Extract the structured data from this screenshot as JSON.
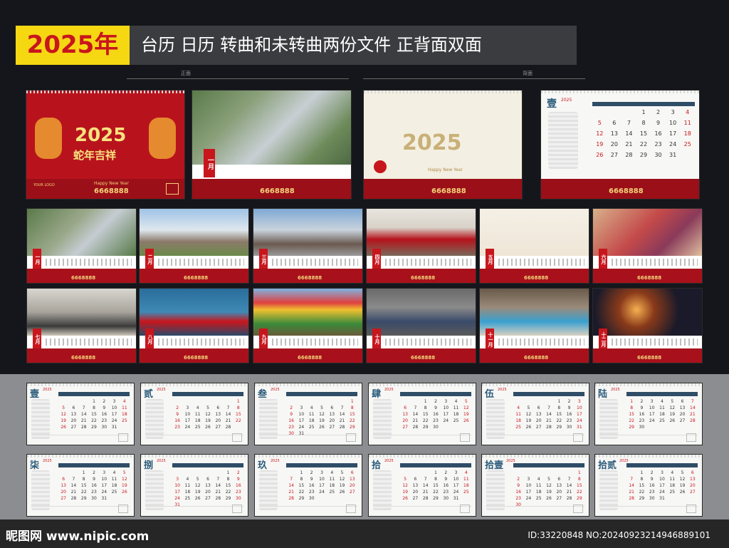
{
  "header": {
    "year": "2025年",
    "title": "台历 日历 转曲和未转曲两份文件 正背面双面",
    "label_front": "正面",
    "label_back": "背面"
  },
  "cover": {
    "year": "2025",
    "blessing": "蛇年吉祥",
    "greeting": "Happy New Year",
    "phone": "6668888",
    "logo": "YOUR LOGO"
  },
  "back_cover": {
    "year": "2025",
    "greeting": "Happy New Year"
  },
  "front_months": [
    {
      "tag": "一月",
      "theme": "aerial"
    },
    {
      "tag": "二月",
      "theme": "building"
    },
    {
      "tag": "三月",
      "theme": "mall"
    },
    {
      "tag": "四月",
      "theme": "sofa"
    },
    {
      "tag": "五月",
      "theme": "floorplan"
    },
    {
      "tag": "六月",
      "theme": "shopping"
    },
    {
      "tag": "七月",
      "theme": "interior"
    },
    {
      "tag": "八月",
      "theme": "ferris"
    },
    {
      "tag": "九月",
      "theme": "kite"
    },
    {
      "tag": "十月",
      "theme": "art"
    },
    {
      "tag": "十一月",
      "theme": "pool"
    },
    {
      "tag": "十二月",
      "theme": "sparkler"
    }
  ],
  "back_months": [
    {
      "num": "壹",
      "start": 3,
      "days": 31
    },
    {
      "num": "贰",
      "start": 6,
      "days": 28
    },
    {
      "num": "叁",
      "start": 6,
      "days": 31
    },
    {
      "num": "肆",
      "start": 2,
      "days": 30
    },
    {
      "num": "伍",
      "start": 4,
      "days": 31
    },
    {
      "num": "陆",
      "start": 0,
      "days": 30
    },
    {
      "num": "柒",
      "start": 2,
      "days": 31
    },
    {
      "num": "捌",
      "start": 5,
      "days": 31
    },
    {
      "num": "玖",
      "start": 1,
      "days": 30
    },
    {
      "num": "拾",
      "start": 3,
      "days": 31
    },
    {
      "num": "拾壹",
      "start": 6,
      "days": 30
    },
    {
      "num": "拾贰",
      "start": 1,
      "days": 31
    }
  ],
  "jan_back_grid": {
    "num": "壹",
    "year": "2025",
    "start": 3,
    "days": 31
  },
  "small_year": "2025",
  "watermark": {
    "site": "昵图网 www.nipic.com",
    "id": "ID:33220848 NO:20240923214946889101"
  }
}
